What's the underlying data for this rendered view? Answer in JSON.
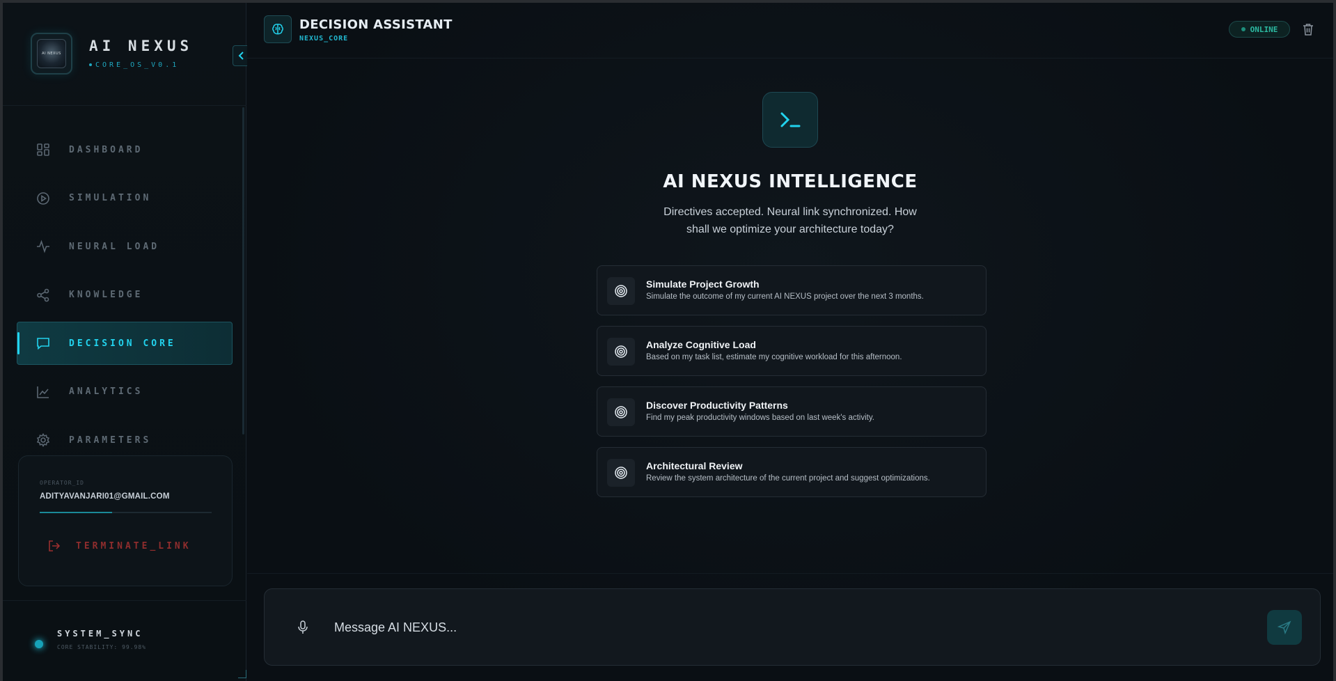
{
  "brand": {
    "logo_text": "AI NEXUS",
    "title": "AI NEXUS",
    "subtitle": "CORE_OS_V0.1"
  },
  "sidebar": {
    "items": [
      {
        "label": "DASHBOARD",
        "icon": "grid-icon",
        "active": false
      },
      {
        "label": "SIMULATION",
        "icon": "play-circle-icon",
        "active": false
      },
      {
        "label": "NEURAL LOAD",
        "icon": "pulse-icon",
        "active": false
      },
      {
        "label": "KNOWLEDGE",
        "icon": "share-nodes-icon",
        "active": false
      },
      {
        "label": "DECISION CORE",
        "icon": "chat-bubble-icon",
        "active": true
      },
      {
        "label": "ANALYTICS",
        "icon": "line-chart-icon",
        "active": false
      },
      {
        "label": "PARAMETERS",
        "icon": "gear-icon",
        "active": false
      }
    ]
  },
  "operator": {
    "label": "OPERATOR_ID",
    "email": "ADITYAVANJARI01@GMAIL.COM",
    "progress": 0.42,
    "terminate_label": "TERMINATE_LINK"
  },
  "system": {
    "title": "SYSTEM_SYNC",
    "stability": "CORE STABILITY: 99.98%"
  },
  "header": {
    "title": "DECISION ASSISTANT",
    "subtitle": "NEXUS_CORE",
    "status": "ONLINE"
  },
  "hero": {
    "title": "AI NEXUS INTELLIGENCE",
    "description": "Directives accepted. Neural link synchronized. How shall we optimize your architecture today?"
  },
  "suggestions": [
    {
      "title": "Simulate Project Growth",
      "desc": "Simulate the outcome of my current AI NEXUS project over the next 3 months."
    },
    {
      "title": "Analyze Cognitive Load",
      "desc": "Based on my task list, estimate my cognitive workload for this afternoon."
    },
    {
      "title": "Discover Productivity Patterns",
      "desc": "Find my peak productivity windows based on last week's activity."
    },
    {
      "title": "Architectural Review",
      "desc": "Review the system architecture of the current project and suggest optimizations."
    }
  ],
  "composer": {
    "placeholder": "Message AI NEXUS..."
  },
  "colors": {
    "accent": "#22d3ee",
    "danger": "#8f2d2d",
    "online": "#2cb9a1",
    "background": "#0a0e13"
  }
}
